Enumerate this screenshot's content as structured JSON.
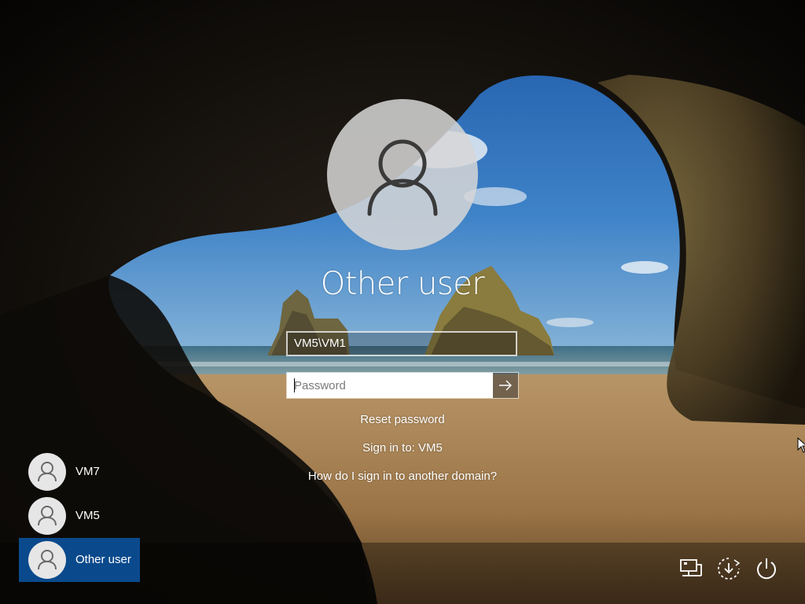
{
  "login": {
    "display_name": "Other user",
    "username_value": "VM5\\VM1",
    "password_placeholder": "Password",
    "reset_password_label": "Reset password",
    "sign_in_to_label": "Sign in to: VM5",
    "another_domain_label": "How do I sign in to another domain?"
  },
  "accounts": [
    {
      "label": "VM7",
      "selected": false
    },
    {
      "label": "VM5",
      "selected": false
    },
    {
      "label": "Other user",
      "selected": true
    }
  ],
  "system_icons": [
    "network-icon",
    "ease-of-access-icon",
    "power-icon"
  ],
  "colors": {
    "selected_account": "#0a4a8c",
    "avatar_bg": "#d6d6d6",
    "sky": "#2f6fb6",
    "sand": "#b08a5a"
  }
}
